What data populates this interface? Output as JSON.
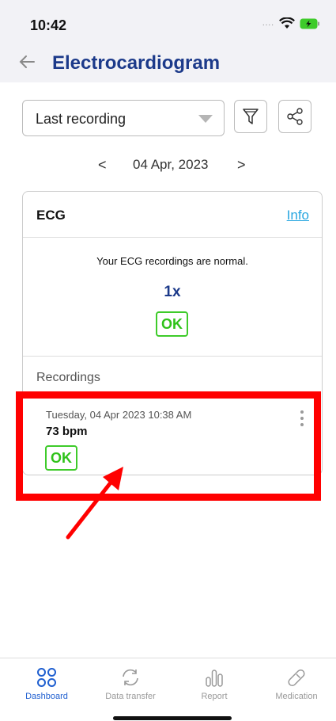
{
  "status_bar": {
    "time": "10:42",
    "signal": "....",
    "icons": [
      "wifi-icon",
      "battery-charging-icon"
    ]
  },
  "header": {
    "title": "Electrocardiogram",
    "back_icon": "arrow-left-icon"
  },
  "filter": {
    "selected": "Last recording",
    "filter_icon": "funnel-icon",
    "share_icon": "share-icon"
  },
  "date_nav": {
    "prev": "<",
    "date": "04 Apr, 2023",
    "next": ">"
  },
  "card": {
    "title": "ECG",
    "info_link": "Info",
    "summary_message": "Your ECG recordings are normal.",
    "count": "1x",
    "status": "OK",
    "recordings_label": "Recordings",
    "recordings": [
      {
        "datetime": "Tuesday, 04 Apr 2023 10:38 AM",
        "bpm": "73 bpm",
        "status": "OK"
      }
    ]
  },
  "annotation": {
    "highlight_color": "#ff0000"
  },
  "tabs": [
    {
      "label": "Dashboard",
      "icon": "dashboard-icon",
      "active": true
    },
    {
      "label": "Data transfer",
      "icon": "sync-icon",
      "active": false
    },
    {
      "label": "Report",
      "icon": "bar-chart-icon",
      "active": false
    },
    {
      "label": "Medication",
      "icon": "pill-icon",
      "active": false
    }
  ],
  "colors": {
    "primary": "#1c3a8a",
    "ok_green": "#2fc21a",
    "link": "#27a6e0",
    "tab_active": "#1f5fd0"
  }
}
